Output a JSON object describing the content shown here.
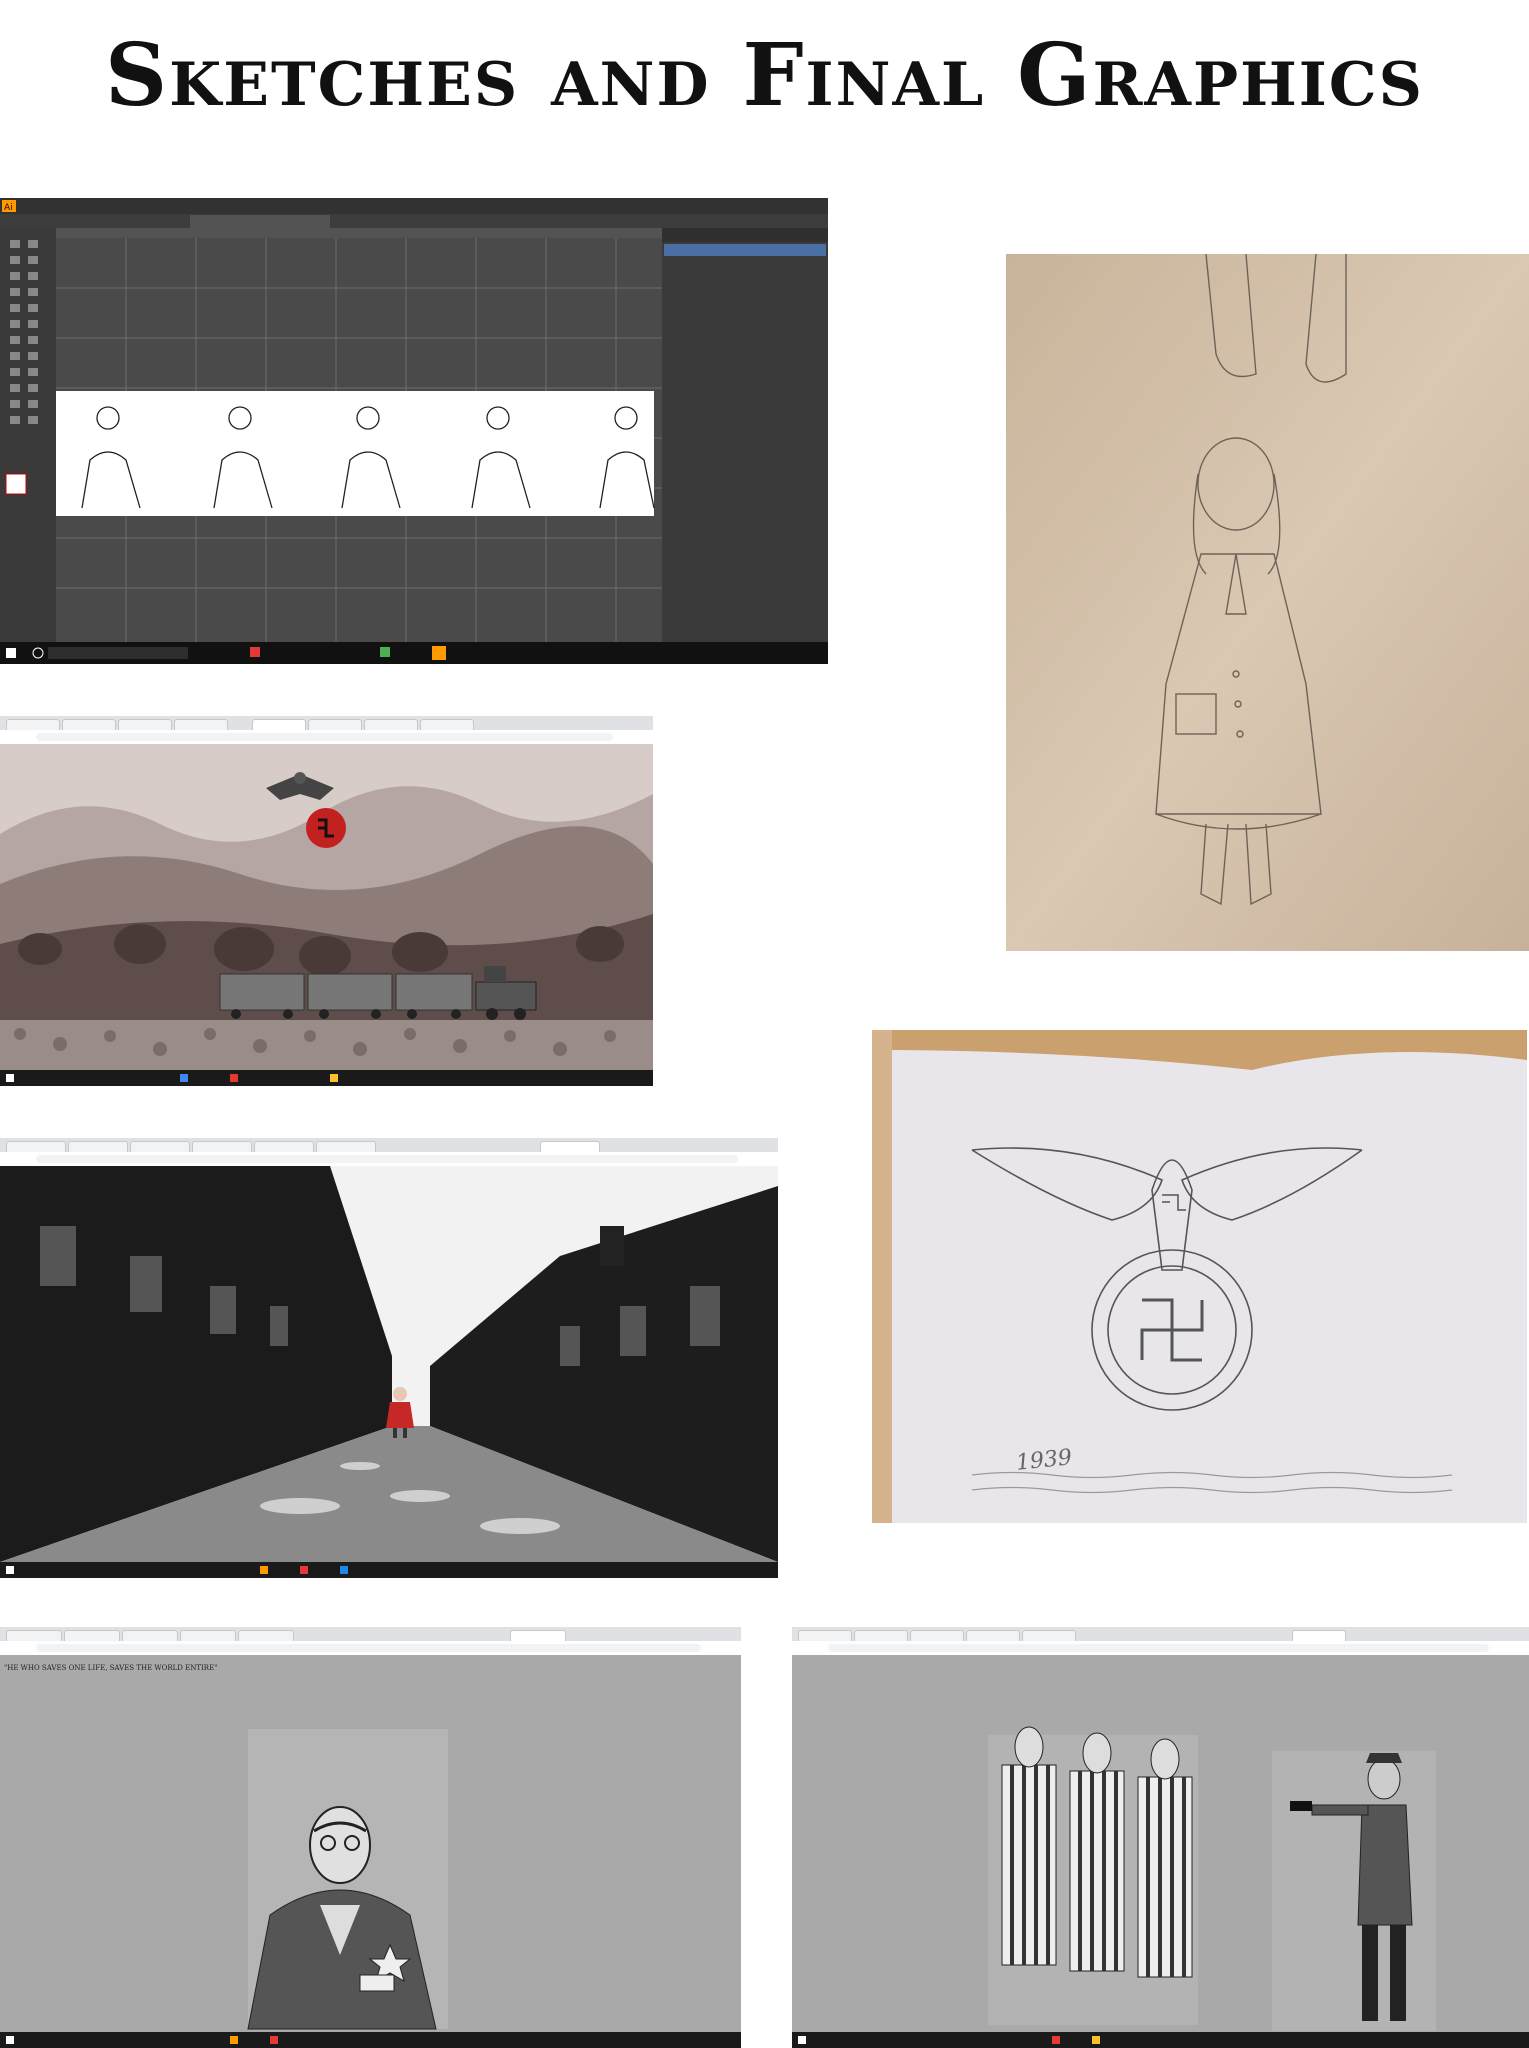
{
  "page": {
    "title": "Sketches and Final Graphics"
  },
  "schindler_screen": {
    "caption": "\"HE WHO SAVES ONE LIFE, SAVES THE WORLD ENTIRE\""
  },
  "eagle_sketch": {
    "year": "1939"
  },
  "colors": {
    "illustrator_bg": "#535353",
    "illustrator_canvas": "#4a4a4a",
    "scene_grey": "#aaaaaa",
    "sepia_sky": "#d8ccc9",
    "red_accent": "#c32020",
    "taskbar": "#1a1a1a"
  },
  "icons": [
    "illustrator-logo",
    "toolbar-tools",
    "windows-start-icon",
    "search-icon",
    "chrome-icon",
    "swastika-emblem",
    "eagle-emblem"
  ]
}
